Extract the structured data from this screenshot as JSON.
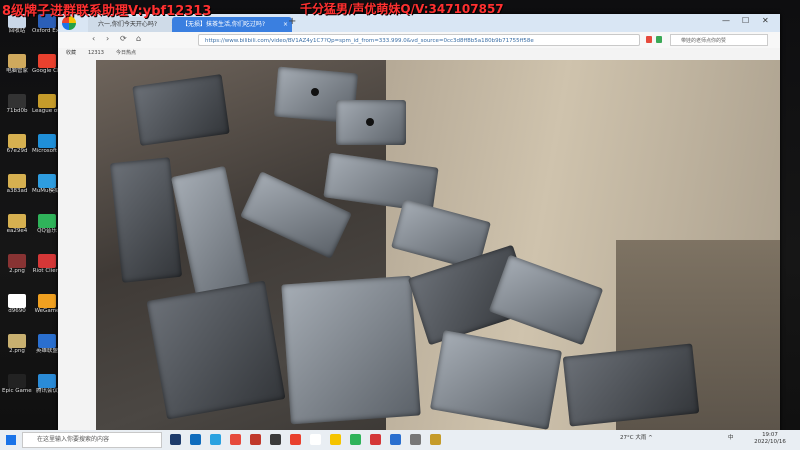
{
  "overlay": {
    "left_text": "8级牌子进群联系助理V:ybf12313",
    "right_text": "千分猛男/声优萌妹Q/V:347107857"
  },
  "desktop_icons": [
    {
      "label": "回收站",
      "color": "#c9d7e8"
    },
    {
      "label": "Oxford Explorer",
      "color": "#2b5fb7"
    },
    {
      "label": "电脑管家",
      "color": "#cfa95d"
    },
    {
      "label": "Google Chrome",
      "color": "#e9412e"
    },
    {
      "label": "71bd0b",
      "color": "#333333"
    },
    {
      "label": "League of Legends",
      "color": "#c59b2a"
    },
    {
      "label": "67e29d",
      "color": "#d6b050"
    },
    {
      "label": "Microsoft Edge",
      "color": "#1f8fd8"
    },
    {
      "label": "a383ad",
      "color": "#d6b050"
    },
    {
      "label": "MuMu模拟器",
      "color": "#2e9de0"
    },
    {
      "label": "ea29e4",
      "color": "#d6b050"
    },
    {
      "label": "QQ音乐",
      "color": "#2fb35a"
    },
    {
      "label": "2.png",
      "color": "#883333"
    },
    {
      "label": "Riot Client",
      "color": "#d43737"
    },
    {
      "label": "d9690",
      "color": "#ffffff"
    },
    {
      "label": "WeGame",
      "color": "#f0a020"
    },
    {
      "label": "2.png",
      "color": "#c8b070"
    },
    {
      "label": "英雄联盟",
      "color": "#2a6fcf"
    },
    {
      "label": "Epic Games Launcher",
      "color": "#222222"
    },
    {
      "label": "腾讯会议",
      "color": "#2a8bd7"
    }
  ],
  "browser": {
    "tabs": [
      {
        "label": "六一,你们今天开心吗?",
        "active": false
      },
      {
        "label": "【无损】抹茶生活,你们吃过吗?",
        "active": true
      }
    ],
    "new_tab": "+",
    "url": "https://www.bilibili.com/video/BV1AZ4y1C7?Qp=spm_id_from=333.999.0&vd_source=0cc3d8ff8b5a180b9b71755ff58e",
    "search_placeholder": "带娃的老师点你的赞",
    "bookmarks": [
      "收藏",
      "12313",
      "今日热点"
    ],
    "nav": {
      "back": "‹",
      "forward": "›",
      "refresh": "⟳",
      "home": "⌂"
    },
    "window": {
      "min": "—",
      "max": "☐",
      "close": "✕"
    }
  },
  "taskbar": {
    "search_placeholder": "在这里输入你要搜索的内容",
    "time": "19:07",
    "date": "2022/10/16",
    "tray_text": "27°C 大雨 ^",
    "ime": "中"
  }
}
